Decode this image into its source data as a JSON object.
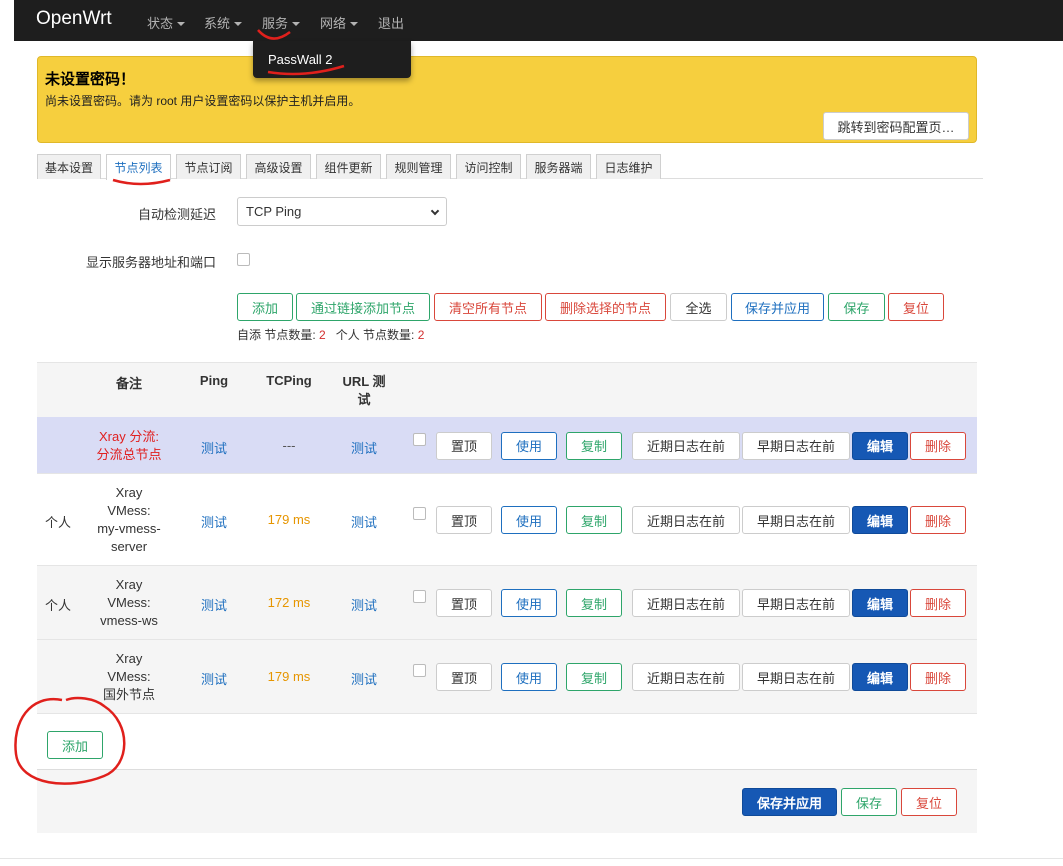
{
  "navbar": {
    "brand": "OpenWrt",
    "items": [
      "状态",
      "系统",
      "服务",
      "网络",
      "退出"
    ],
    "dropdown_item": "PassWall 2"
  },
  "alert": {
    "title": "未设置密码！",
    "text": "尚未设置密码。请为 root 用户设置密码以保护主机并启用。",
    "button": "跳转到密码配置页…"
  },
  "tabs": [
    "基本设置",
    "节点列表",
    "节点订阅",
    "高级设置",
    "组件更新",
    "规则管理",
    "访问控制",
    "服务器端",
    "日志维护"
  ],
  "active_tab": "节点列表",
  "form": {
    "latency_label": "自动检测延迟",
    "latency_value": "TCP Ping",
    "show_addr_label": "显示服务器地址和端口"
  },
  "actions": [
    "添加",
    "通过链接添加节点",
    "清空所有节点",
    "删除选择的节点",
    "全选",
    "保存并应用",
    "保存",
    "复位"
  ],
  "counts": {
    "self_label": "自添 节点数量:",
    "self_value": "2",
    "personal_label": "个人 节点数量:",
    "personal_value": "2"
  },
  "table": {
    "headers": [
      "备注",
      "Ping",
      "TCPing",
      "URL 测\n试"
    ],
    "row_buttons": [
      "置顶",
      "使用",
      "复制",
      "近期日志在前",
      "早期日志在前",
      "编辑",
      "删除"
    ],
    "rows": [
      {
        "group": "",
        "remark": [
          "Xray 分流:",
          "分流总节点"
        ],
        "ping": "测试",
        "tcping": "---",
        "url": "测试"
      },
      {
        "group": "个人",
        "remark": [
          "Xray",
          "VMess:",
          "my-vmess-",
          "server"
        ],
        "ping": "测试",
        "tcping": "179 ms",
        "url": "测试"
      },
      {
        "group": "个人",
        "remark": [
          "Xray",
          "VMess:",
          "vmess-ws"
        ],
        "ping": "测试",
        "tcping": "172 ms",
        "url": "测试"
      },
      {
        "group": "",
        "remark": [
          "Xray",
          "VMess:",
          "国外节点"
        ],
        "ping": "测试",
        "tcping": "179 ms",
        "url": "测试"
      }
    ]
  },
  "add_button": "添加",
  "footer": {
    "save_apply": "保存并应用",
    "save": "保存",
    "reset": "复位"
  },
  "colors": {
    "navbar": "#1e1e1e",
    "alert": "#f6cf3e",
    "primary": "#1658b4",
    "green": "#2ea56a",
    "red": "#d9473b",
    "annotation": "#e0201c"
  }
}
